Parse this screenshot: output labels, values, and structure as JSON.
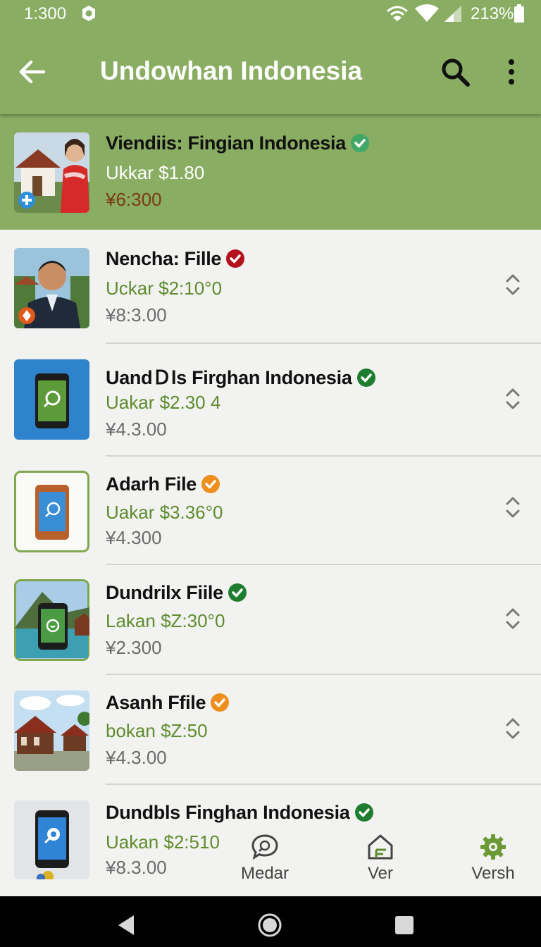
{
  "status_bar": {
    "time": "1:300",
    "battery": "213%"
  },
  "app_bar": {
    "title": "Undowhan Indonesia",
    "back_icon": "arrow-left-icon",
    "search_icon": "search-icon",
    "more_icon": "more-vert-icon"
  },
  "colors": {
    "brand_green": "#89ad62",
    "price_green": "#5e8c2e",
    "verified_green": "#1e7d2e",
    "verified_red": "#b3121c",
    "verified_orange": "#ec8f1e"
  },
  "items": [
    {
      "title": "Viendiis: Fingian Indonesia",
      "price_primary": "Ukkar $1.80",
      "price_secondary": "¥6:300",
      "badge": "green",
      "selected": true
    },
    {
      "title": "Nencha: Fille",
      "price_primary": "Uckar $2:10°0",
      "price_secondary": "¥8:3.00",
      "badge": "red",
      "selected": false
    },
    {
      "title": "UandＤls Firghan Indonesia",
      "price_primary": "Uakar $2.30 4",
      "price_secondary": "¥4.3.00",
      "badge": "green",
      "selected": false
    },
    {
      "title": "Adarh File",
      "price_primary": "Uakar $3.36°0",
      "price_secondary": "¥4.300",
      "badge": "orange",
      "selected": false
    },
    {
      "title": "Dundrilx Fiile",
      "price_primary": "Lakan $Z:30°0",
      "price_secondary": "¥2.300",
      "badge": "green",
      "selected": false
    },
    {
      "title": "Asanh Ffile",
      "price_primary": "bokan $Z:50",
      "price_secondary": "¥4.3.00",
      "badge": "orange",
      "selected": false
    },
    {
      "title": "Dundbls Finghan Indonesia",
      "price_primary": "Uakan $2:510",
      "price_secondary": "¥8.3.00",
      "badge": "green",
      "selected": false
    }
  ],
  "bottom_nav": [
    {
      "label": "Medar",
      "icon": "chat-bubble-icon"
    },
    {
      "label": "Ver",
      "icon": "home-icon"
    },
    {
      "label": "Versh",
      "icon": "gear-icon"
    }
  ]
}
